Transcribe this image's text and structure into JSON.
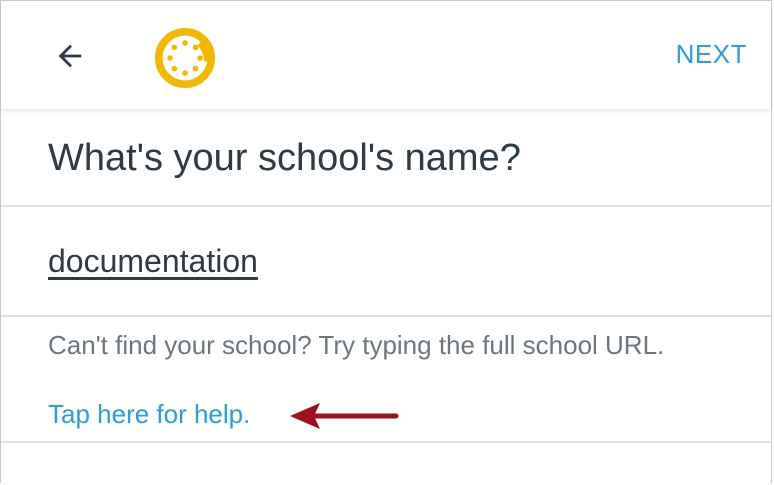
{
  "header": {
    "back_icon": "arrow-left-icon",
    "logo_icon": "canvas-logo-icon",
    "next_label": "NEXT"
  },
  "main": {
    "title": "What's your school's name?",
    "school_input": {
      "value": "documentation"
    },
    "help_text": "Can't find your school? Try typing the full school URL.",
    "help_link": "Tap here for help."
  },
  "annotation": {
    "arrow_icon": "arrow-left-icon"
  },
  "colors": {
    "accent": "#2b9ee0",
    "logo": "#f5b800",
    "annotation_arrow": "#a0101c",
    "text_dark": "#2d3b45",
    "text_muted": "#6b7780"
  }
}
